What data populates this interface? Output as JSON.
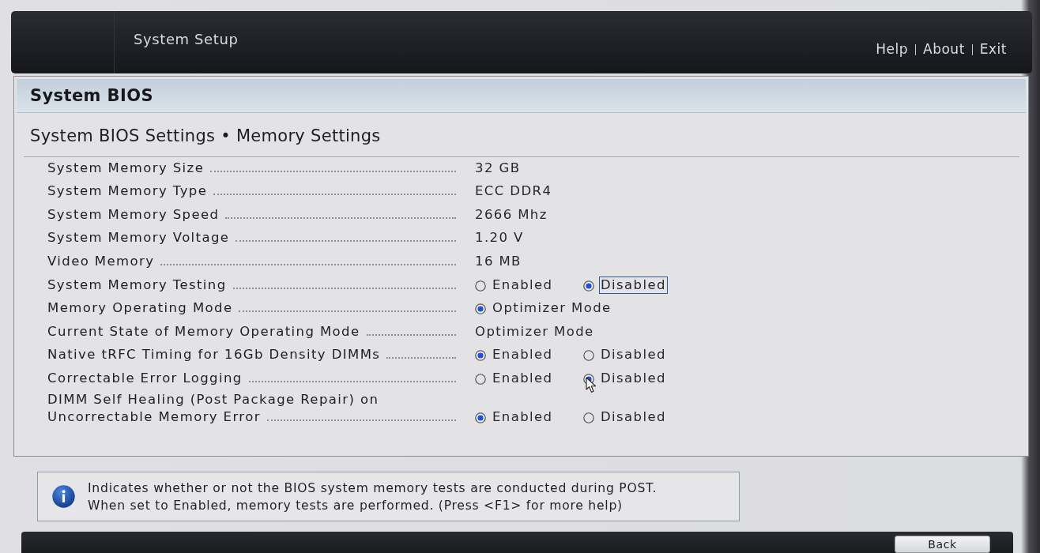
{
  "header": {
    "title": "System Setup",
    "links": [
      "Help",
      "About",
      "Exit"
    ]
  },
  "panel": {
    "title": "System BIOS",
    "subtitle": "System BIOS Settings • Memory Settings",
    "settings": [
      {
        "label": "System Memory Size",
        "kind": "value",
        "value": "32 GB"
      },
      {
        "label": "System Memory Type",
        "kind": "value",
        "value": "ECC DDR4"
      },
      {
        "label": "System Memory Speed",
        "kind": "value",
        "value": "2666 Mhz"
      },
      {
        "label": "System Memory Voltage",
        "kind": "value",
        "value": "1.20 V"
      },
      {
        "label": "Video Memory",
        "kind": "value",
        "value": "16 MB"
      },
      {
        "label": "System Memory Testing",
        "kind": "radio",
        "options": [
          {
            "label": "Enabled",
            "selected": false,
            "focused": false,
            "hovered": false
          },
          {
            "label": "Disabled",
            "selected": true,
            "focused": true,
            "hovered": false
          }
        ]
      },
      {
        "label": "Memory Operating Mode",
        "kind": "radio",
        "options": [
          {
            "label": "Optimizer Mode",
            "selected": true,
            "focused": false,
            "hovered": false
          }
        ]
      },
      {
        "label": "Current State of Memory Operating Mode",
        "kind": "value",
        "value": "Optimizer Mode"
      },
      {
        "label": "Native tRFC Timing for 16Gb Density DIMMs",
        "kind": "radio",
        "options": [
          {
            "label": "Enabled",
            "selected": true,
            "focused": false,
            "hovered": false
          },
          {
            "label": "Disabled",
            "selected": false,
            "focused": false,
            "hovered": false
          }
        ]
      },
      {
        "label": "Correctable Error Logging",
        "kind": "radio",
        "options": [
          {
            "label": "Enabled",
            "selected": false,
            "focused": false,
            "hovered": false
          },
          {
            "label": "Disabled",
            "selected": true,
            "focused": false,
            "hovered": true
          }
        ]
      },
      {
        "label": "DIMM Self Healing (Post Package Repair) on Uncorrectable Memory Error",
        "kind": "radio",
        "options": [
          {
            "label": "Enabled",
            "selected": true,
            "focused": false,
            "hovered": false
          },
          {
            "label": "Disabled",
            "selected": false,
            "focused": false,
            "hovered": false
          }
        ]
      }
    ]
  },
  "help": {
    "text": "Indicates whether or not the BIOS system memory tests are conducted during POST.\nWhen set to Enabled, memory tests are performed. (Press <F1> for more help)"
  },
  "footer": {
    "buttons": [
      {
        "label": "Back"
      }
    ]
  }
}
